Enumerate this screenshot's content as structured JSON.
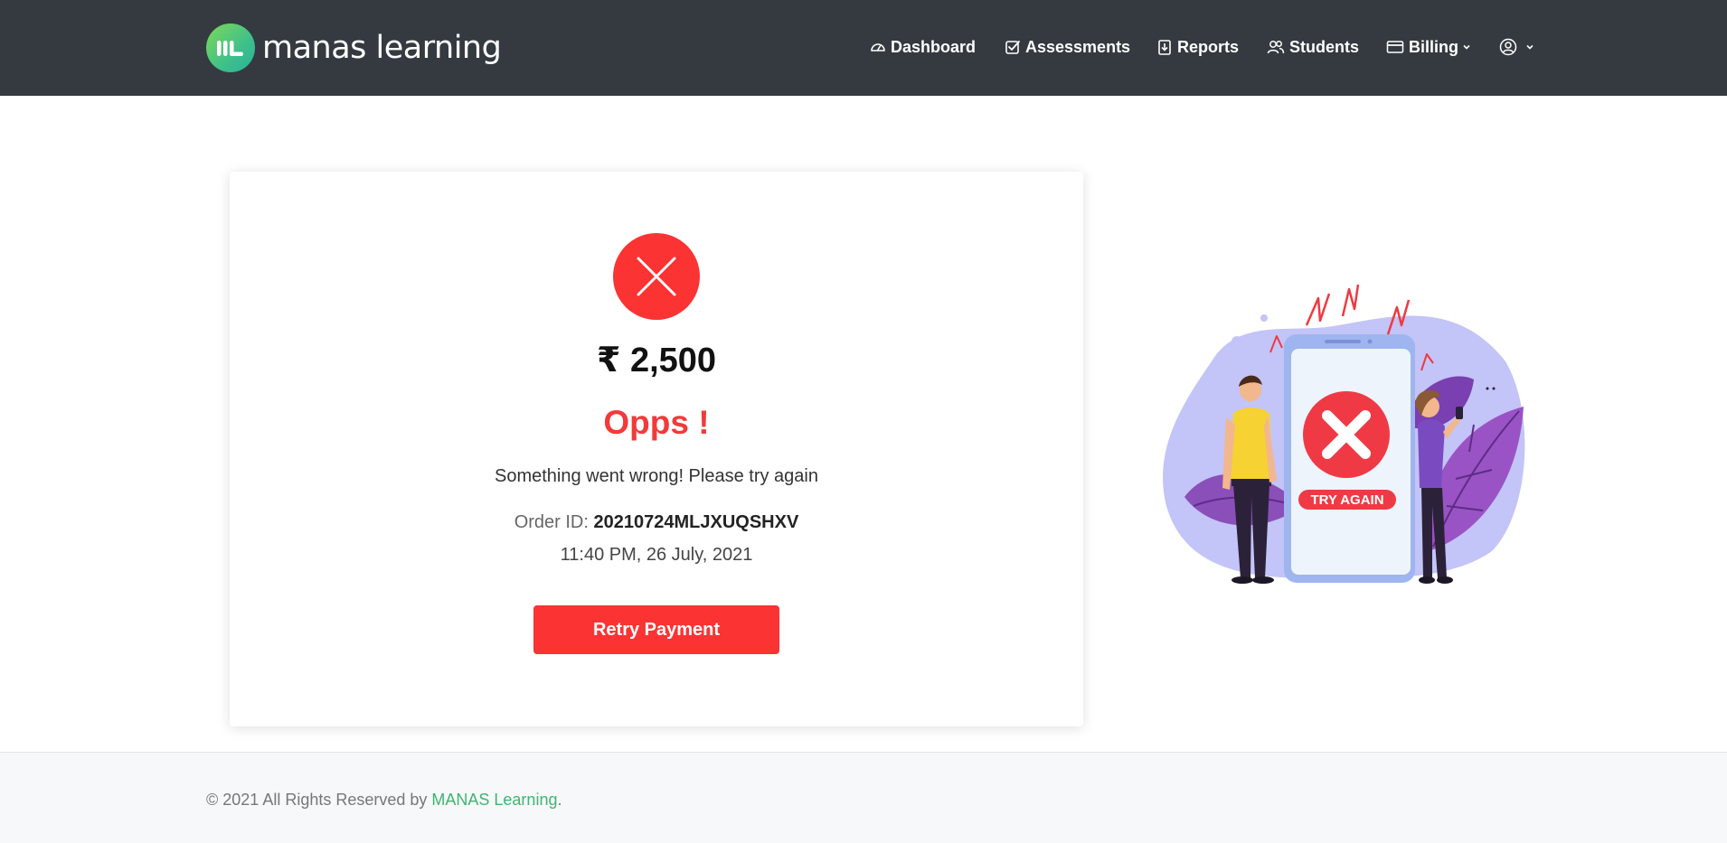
{
  "navbar": {
    "brand": "manas learning",
    "items": [
      {
        "label": "Dashboard",
        "icon": "dashboard-gauge-icon"
      },
      {
        "label": "Assessments",
        "icon": "checkbox-icon"
      },
      {
        "label": "Reports",
        "icon": "download-doc-icon"
      },
      {
        "label": "Students",
        "icon": "users-icon"
      },
      {
        "label": "Billing",
        "icon": "credit-card-icon"
      }
    ],
    "profile_icon": "user-circle-icon"
  },
  "payment": {
    "status_icon": "close-x-icon",
    "amount": "₹ 2,500",
    "title": "Opps !",
    "message": "Something went wrong! Please try again",
    "order_label": "Order ID:",
    "order_id": "20210724MLJXUQSHXV",
    "datetime": "11:40 PM, 26 July, 2021",
    "retry_label": "Retry Payment"
  },
  "illustration": {
    "badge_text": "TRY AGAIN"
  },
  "footer": {
    "prefix": "© 2021 All Rights Reserved by ",
    "link": "MANAS Learning",
    "suffix": "."
  },
  "colors": {
    "navbar_bg": "#343a40",
    "error_red": "#fb3333",
    "brand_green": "#3fb572",
    "footer_bg": "#f7f8f9"
  }
}
